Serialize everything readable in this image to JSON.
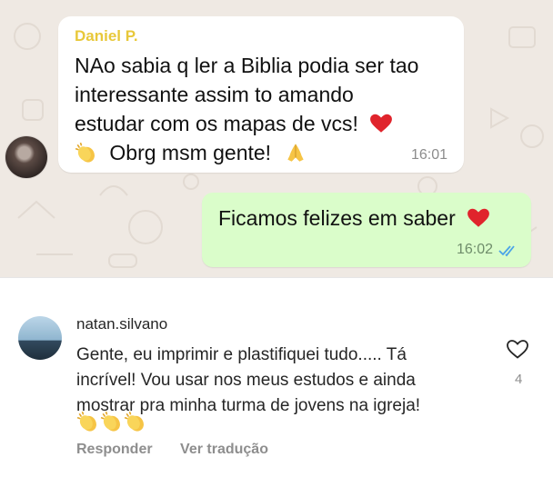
{
  "whatsapp": {
    "incoming": {
      "sender": "Daniel P.",
      "text_line1": "NAo sabia q ler a Biblia podia ser tao",
      "text_line2": "interessante assim to amando",
      "text_line3": "estudar com os mapas de vcs!",
      "text_line4": "Obrg msm gente!",
      "time": "16:01"
    },
    "outgoing": {
      "text": "Ficamos felizes em saber",
      "time": "16:02",
      "status_icon": "double-check-read-icon"
    },
    "colors": {
      "chat_background": "#efe9e3",
      "outgoing_bubble": "#dafdca",
      "sender_name": "#e8c83a",
      "read_ticks": "#4aa3e8"
    }
  },
  "comment": {
    "username": "natan.silvano",
    "text_line1": "Gente, eu imprimir e plastifiquei tudo..... Tá",
    "text_line2": "incrível! Vou usar nos meus estudos e ainda",
    "text_line3": "mostrar pra minha turma de jovens na igreja!",
    "reply_label": "Responder",
    "translate_label": "Ver tradução",
    "like_count": "4",
    "like_icon": "heart-outline-icon"
  }
}
